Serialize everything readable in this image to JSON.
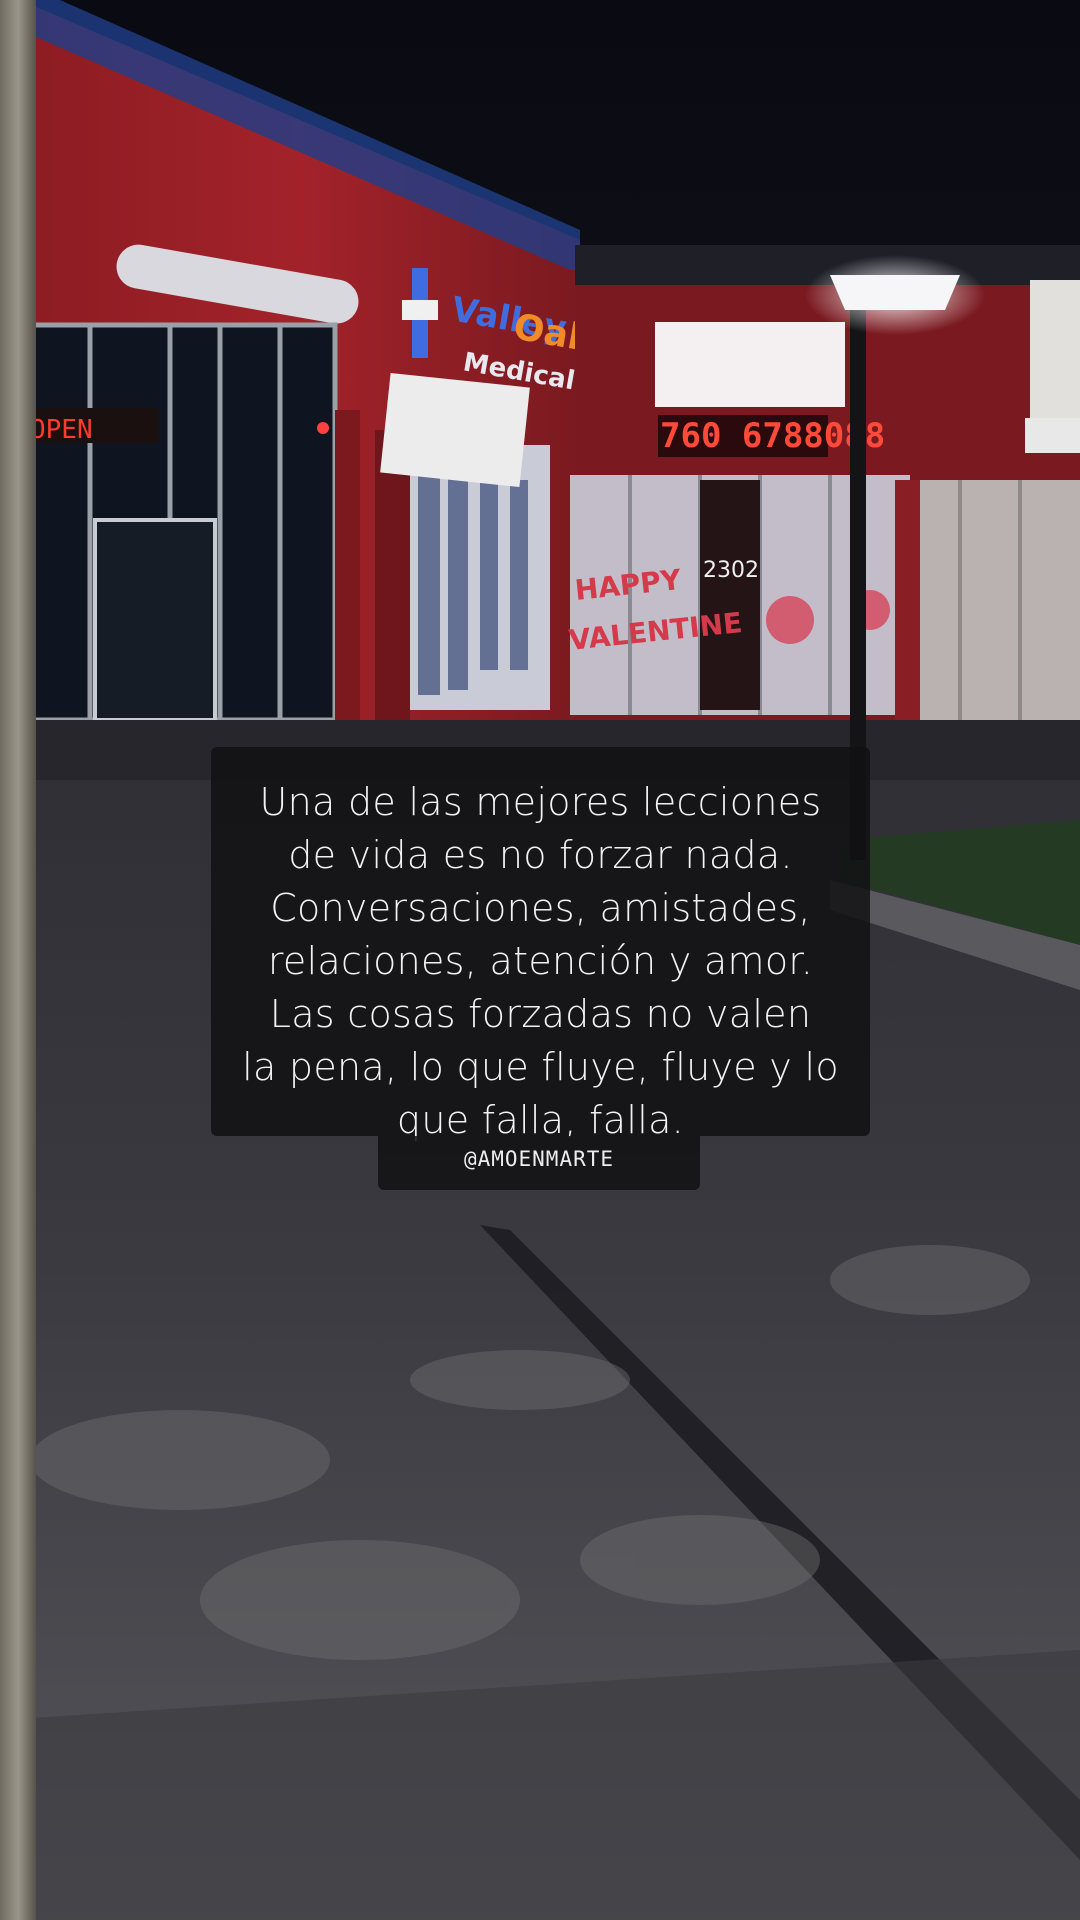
{
  "photo": {
    "medical_sign_line1": "Valley Oaks",
    "medical_sign_line2": "Medical",
    "phone_sign": "760 6788088",
    "address_number": "2302",
    "valentine_text_1": "HAPPY",
    "valentine_text_2": "VALENTINE",
    "accent_red": "#b0232d",
    "accent_blue": "#2f6ddb",
    "neon_red": "#ff3a2e"
  },
  "quote": {
    "lines": [
      "Una de las mejores lecciones",
      "de vida es no forzar nada.",
      "Conversaciones, amistades,",
      "relaciones, atención y amor.",
      "Las cosas forzadas no valen",
      "la pena, lo que fluye, fluye y lo",
      "que falla, falla."
    ],
    "handle": "@AMOENMARTE"
  }
}
